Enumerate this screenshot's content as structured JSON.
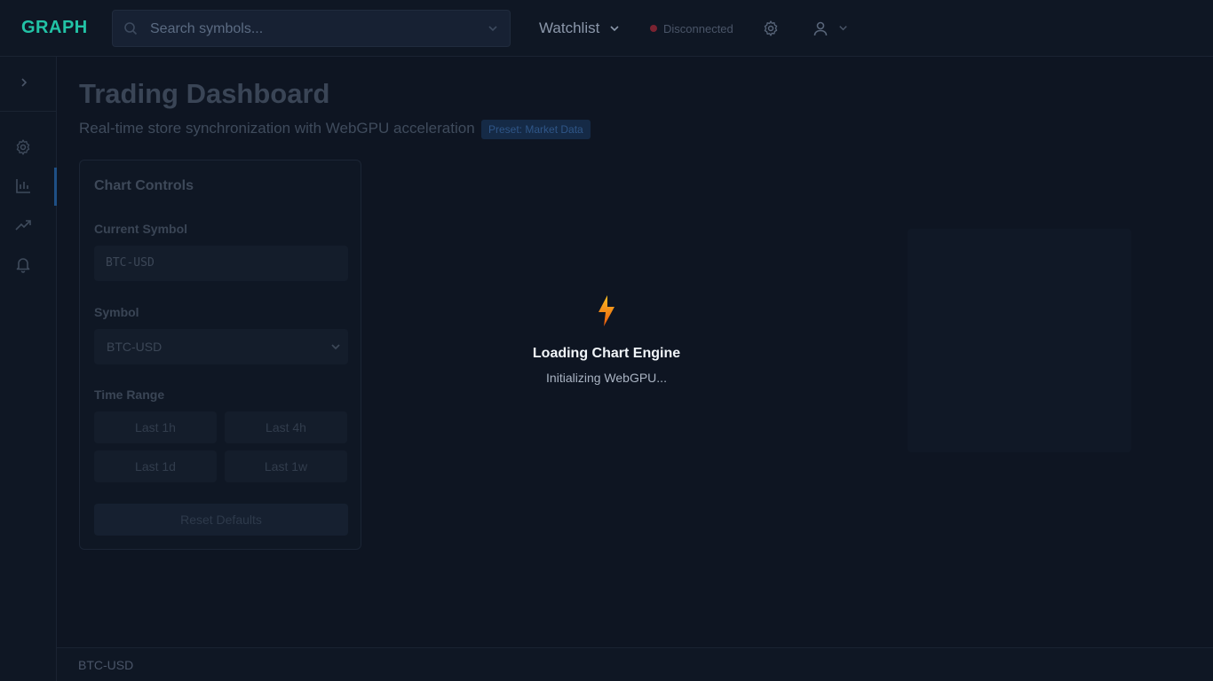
{
  "header": {
    "logo": "GRAPH",
    "search_placeholder": "Search symbols...",
    "watchlist_label": "Watchlist",
    "status": {
      "text": "Disconnected",
      "color": "#ef4444"
    }
  },
  "page": {
    "title": "Trading Dashboard",
    "subtitle": "Real-time store synchronization with WebGPU acceleration",
    "badge": "Preset: Market Data"
  },
  "controls": {
    "title": "Chart Controls",
    "current_symbol_label": "Current Symbol",
    "current_symbol_value": "BTC-USD",
    "symbol_label": "Symbol",
    "symbol_selected": "BTC-USD",
    "time_range_label": "Time Range",
    "ranges": [
      "Last 1h",
      "Last 4h",
      "Last 1d",
      "Last 1w"
    ],
    "reset_label": "Reset Defaults"
  },
  "loading": {
    "title": "Loading Chart Engine",
    "subtitle": "Initializing WebGPU..."
  },
  "footer": {
    "symbol": "BTC-USD"
  },
  "icons": {
    "sidebar": [
      "chevron-right-icon",
      "gear-icon",
      "bar-chart-icon",
      "trending-up-icon",
      "bell-icon"
    ],
    "loading": "lightning-bolt-icon"
  },
  "colors": {
    "accent": "#22c3a6",
    "bolt": "#f59e0b",
    "background": "#0e1522"
  }
}
